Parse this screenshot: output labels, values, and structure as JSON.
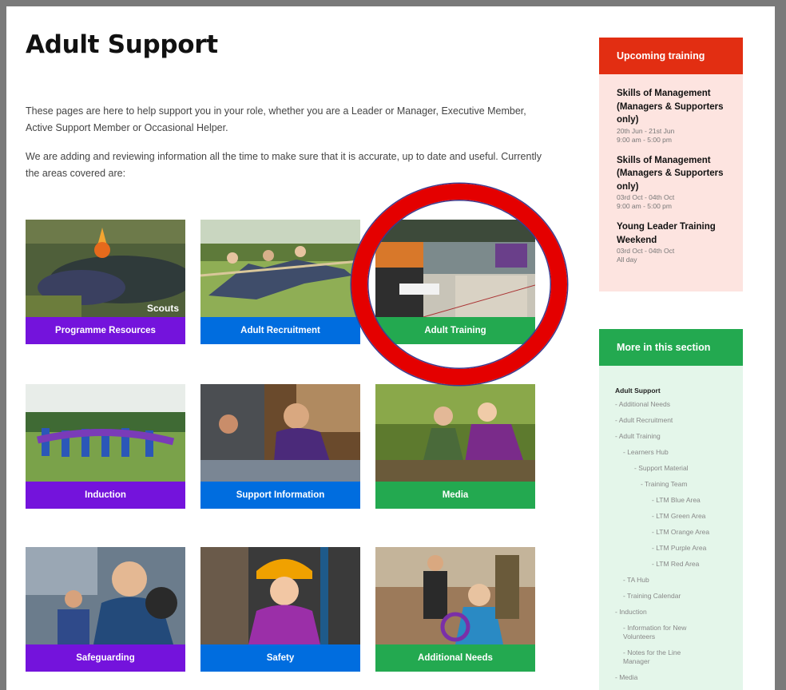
{
  "page": {
    "title": "Adult Support",
    "intro1": "These pages are here to help support you in your role, whether you are a Leader or Manager, Executive Member, Active Support Member or Occasional Helper.",
    "intro2": "We are adding and reviewing information all the time to make sure that it is accurate, up to date and useful. Currently the areas covered are:"
  },
  "tiles": [
    {
      "label": "Programme Resources",
      "color": "#7413dc"
    },
    {
      "label": "Adult Recruitment",
      "color": "#006ddf"
    },
    {
      "label": "Adult Training",
      "color": "#23a950"
    },
    {
      "label": "Induction",
      "color": "#7413dc"
    },
    {
      "label": "Support Information",
      "color": "#006ddf"
    },
    {
      "label": "Media",
      "color": "#23a950"
    },
    {
      "label": "Safeguarding",
      "color": "#7413dc"
    },
    {
      "label": "Safety",
      "color": "#006ddf"
    },
    {
      "label": "Additional Needs",
      "color": "#23a950"
    }
  ],
  "tile_logo": "Scouts",
  "training": {
    "heading": "Upcoming training",
    "events": [
      {
        "title": "Skills of Management (Managers & Supporters only)",
        "dates": "20th Jun - 21st Jun",
        "time": "9:00 am - 5:00 pm"
      },
      {
        "title": "Skills of Management (Managers & Supporters only)",
        "dates": "03rd Oct - 04th Oct",
        "time": "9:00 am - 5:00 pm"
      },
      {
        "title": "Young Leader Training Weekend",
        "dates": "03rd Oct - 04th Oct",
        "time": "All day"
      }
    ]
  },
  "section": {
    "heading": "More in this section",
    "root": "Adult Support",
    "items": [
      {
        "label": "- Additional Needs",
        "level": 0
      },
      {
        "label": "- Adult Recruitment",
        "level": 0
      },
      {
        "label": "- Adult Training",
        "level": 0
      },
      {
        "label": "- Learners Hub",
        "level": 1
      },
      {
        "label": "- Support Material",
        "level": 2
      },
      {
        "label": "- Training Team",
        "level": 3
      },
      {
        "label": "- LTM Blue Area",
        "level": 4
      },
      {
        "label": "- LTM Green Area",
        "level": 4
      },
      {
        "label": "- LTM Orange Area",
        "level": 4
      },
      {
        "label": "- LTM Purple Area",
        "level": 4
      },
      {
        "label": "- LTM Red Area",
        "level": 4
      },
      {
        "label": "- TA Hub",
        "level": 1
      },
      {
        "label": "- Training Calendar",
        "level": 1
      },
      {
        "label": "- Induction",
        "level": 0
      },
      {
        "label": "- Information for New Volunteers",
        "level": 1
      },
      {
        "label": "- Notes for the Line Manager",
        "level": 1
      },
      {
        "label": "- Media",
        "level": 0
      }
    ]
  },
  "colors": {
    "purple": "#7413dc",
    "blue": "#006ddf",
    "green": "#23a950",
    "red_accent": "#e22e12",
    "highlight_ring": "#e40000"
  }
}
